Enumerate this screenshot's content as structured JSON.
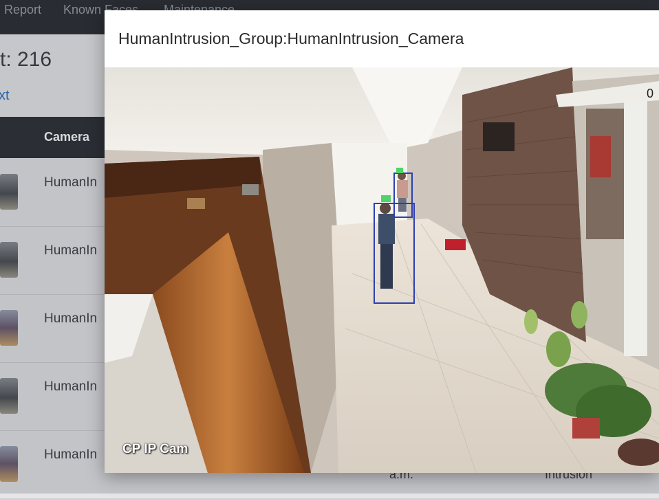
{
  "nav": {
    "items": [
      "Report",
      "Known Faces",
      "Maintenance"
    ]
  },
  "summary": {
    "count_label": "t: 216",
    "next_link": "xt"
  },
  "table": {
    "camera_header": "Camera",
    "rows": [
      {
        "camera": "HumanIn"
      },
      {
        "camera": "HumanIn"
      },
      {
        "camera": "HumanIn"
      },
      {
        "camera": "HumanIn"
      },
      {
        "camera": "HumanIn"
      }
    ],
    "bottom_time": "a.m.",
    "bottom_type": "Intrusion"
  },
  "modal": {
    "title": "HumanIntrusion_Group:HumanIntrusion_Camera",
    "camera_label": "CP IP Cam",
    "timestamp_fragment": "0"
  },
  "colors": {
    "detection_box": "#2d3fb0",
    "detection_head": "#4fd36a",
    "nav_bg": "#2a2d33",
    "link": "#2b6fc0"
  }
}
